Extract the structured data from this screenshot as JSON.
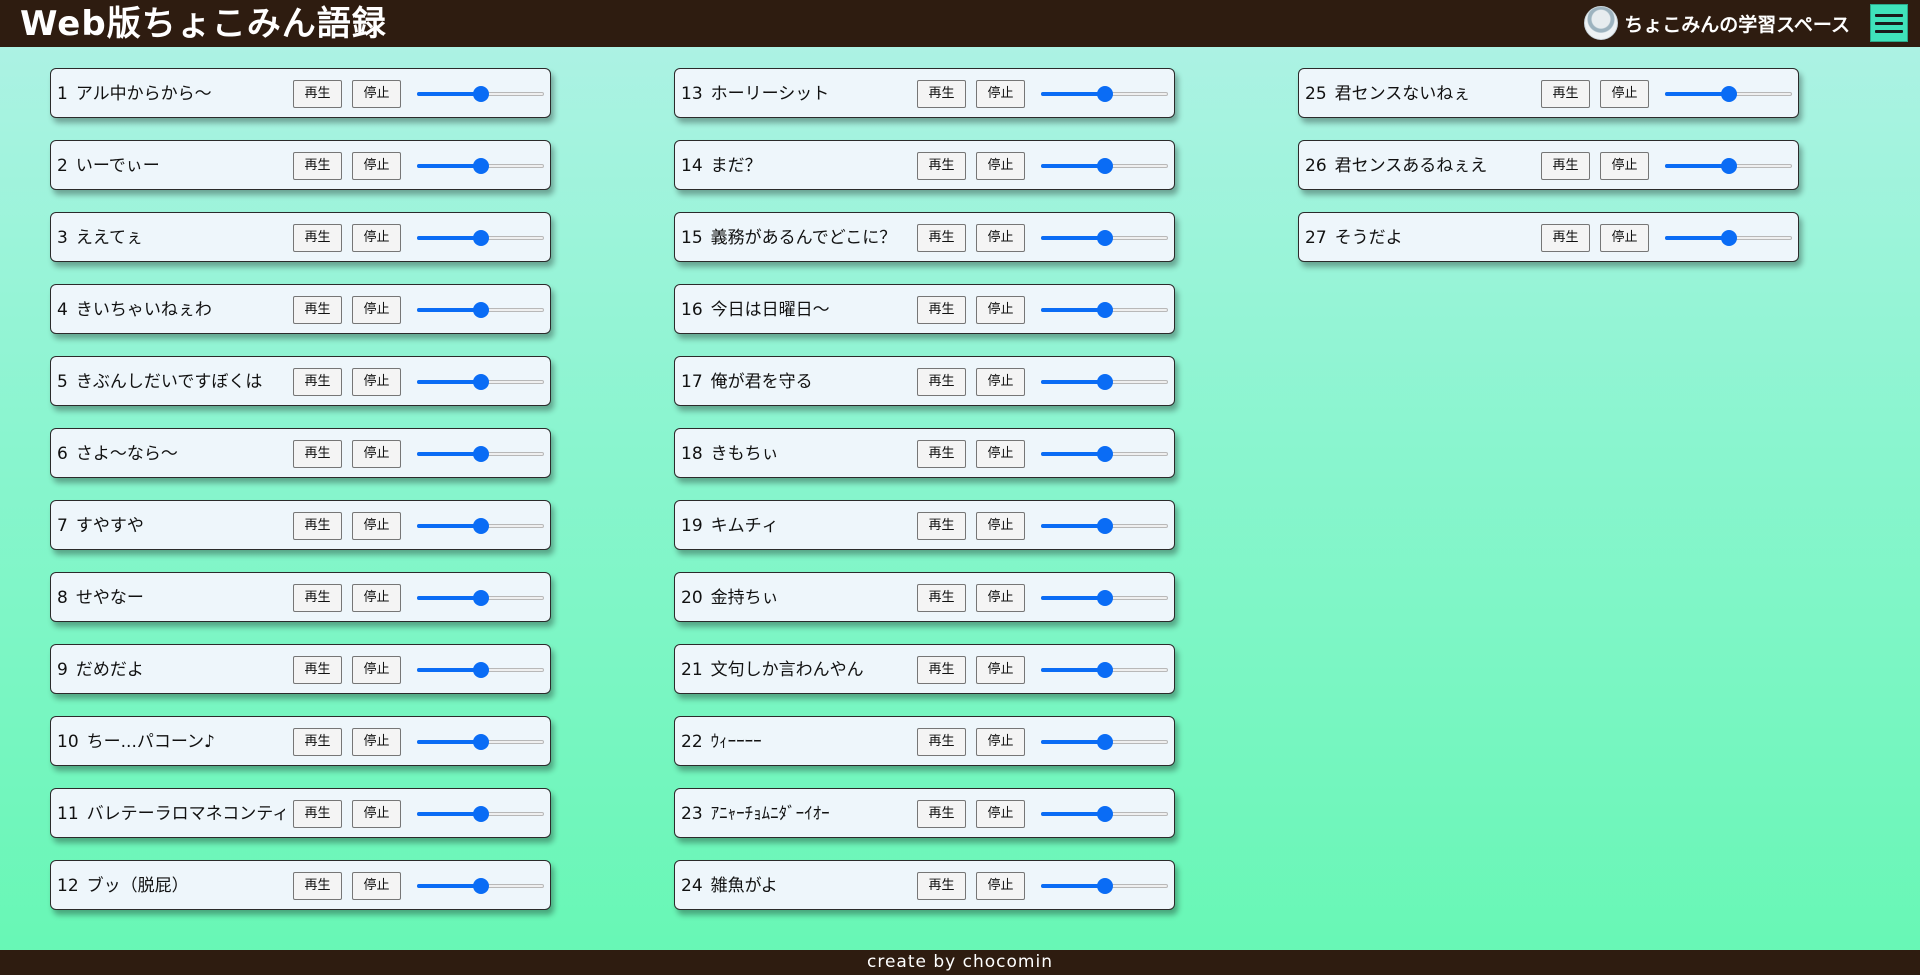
{
  "header": {
    "title": "Web版ちょこみん語録",
    "profile_name": "ちょこみんの学習スペース",
    "avatar_icon": "avatar-image",
    "menu_icon": "hamburger-icon"
  },
  "controls": {
    "play_label": "再生",
    "stop_label": "停止"
  },
  "volume_default": 0.5,
  "accent_color": "#0a6cf5",
  "columns": [
    [
      {
        "num": "1",
        "title": "アル中からから～"
      },
      {
        "num": "2",
        "title": "いーでぃー"
      },
      {
        "num": "3",
        "title": "ええてぇ"
      },
      {
        "num": "4",
        "title": "きいちゃいねぇわ"
      },
      {
        "num": "5",
        "title": "きぶんしだいですぼくは"
      },
      {
        "num": "6",
        "title": "さよ～なら～"
      },
      {
        "num": "7",
        "title": "すやすや"
      },
      {
        "num": "8",
        "title": "せやなー"
      },
      {
        "num": "9",
        "title": "だめだよ"
      },
      {
        "num": "10",
        "title": "ちー...パコーン♪"
      },
      {
        "num": "11",
        "title": "バレテーラロマネコンティ-"
      },
      {
        "num": "12",
        "title": "ブッ（脱屁）"
      }
    ],
    [
      {
        "num": "13",
        "title": "ホーリーシット"
      },
      {
        "num": "14",
        "title": "まだ？"
      },
      {
        "num": "15",
        "title": "義務があるんでどこに？"
      },
      {
        "num": "16",
        "title": "今日は日曜日～"
      },
      {
        "num": "17",
        "title": "俺が君を守る"
      },
      {
        "num": "18",
        "title": "きもちぃ"
      },
      {
        "num": "19",
        "title": "キムチィ"
      },
      {
        "num": "20",
        "title": "金持ちぃ"
      },
      {
        "num": "21",
        "title": "文句しか言わんやん"
      },
      {
        "num": "22",
        "title": "ｳｨｰｰｰｰ"
      },
      {
        "num": "23",
        "title": "ｱﾆｬｰﾁｮﾑﾆﾀﾞｰｲｵｰ"
      },
      {
        "num": "24",
        "title": "雑魚がよ"
      }
    ],
    [
      {
        "num": "25",
        "title": "君センスないねぇ"
      },
      {
        "num": "26",
        "title": "君センスあるねぇえ"
      },
      {
        "num": "27",
        "title": "そうだよ"
      }
    ]
  ],
  "footer": {
    "text": "create by chocomin"
  }
}
